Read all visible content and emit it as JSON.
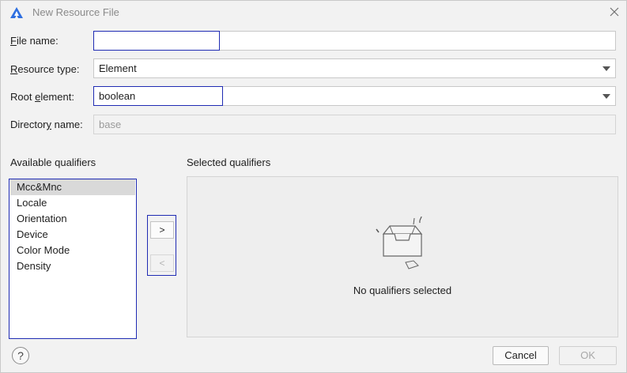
{
  "window": {
    "title": "New Resource File",
    "logo_icon": "ide-logo-icon",
    "close_icon": "close-icon"
  },
  "form": {
    "file_name": {
      "label_prefix": "",
      "label_mnemonic": "F",
      "label_rest": "ile name:",
      "value": ""
    },
    "resource_type": {
      "label_prefix": "",
      "label_mnemonic": "R",
      "label_rest": "esource type:",
      "value": "Element"
    },
    "root_element": {
      "label_prefix": "Root ",
      "label_mnemonic": "e",
      "label_rest": "lement:",
      "value": "boolean"
    },
    "directory_name": {
      "label_prefix": "Director",
      "label_mnemonic": "y",
      "label_rest": " name:",
      "value": "base"
    }
  },
  "qualifiers": {
    "available_label": "Available qualifiers",
    "selected_label": "Selected qualifiers",
    "items": [
      "Mcc&Mnc",
      "Locale",
      "Orientation",
      "Device",
      "Color Mode",
      "Density"
    ],
    "selected_index": 0,
    "add_button": ">",
    "remove_button": "<",
    "empty_text": "No qualifiers selected"
  },
  "footer": {
    "help": "?",
    "cancel": "Cancel",
    "ok": "OK"
  },
  "colors": {
    "focus_border": "#1f2bb3",
    "dialog_bg": "#f2f2f2",
    "logo_blue": "#2f6fe0"
  }
}
